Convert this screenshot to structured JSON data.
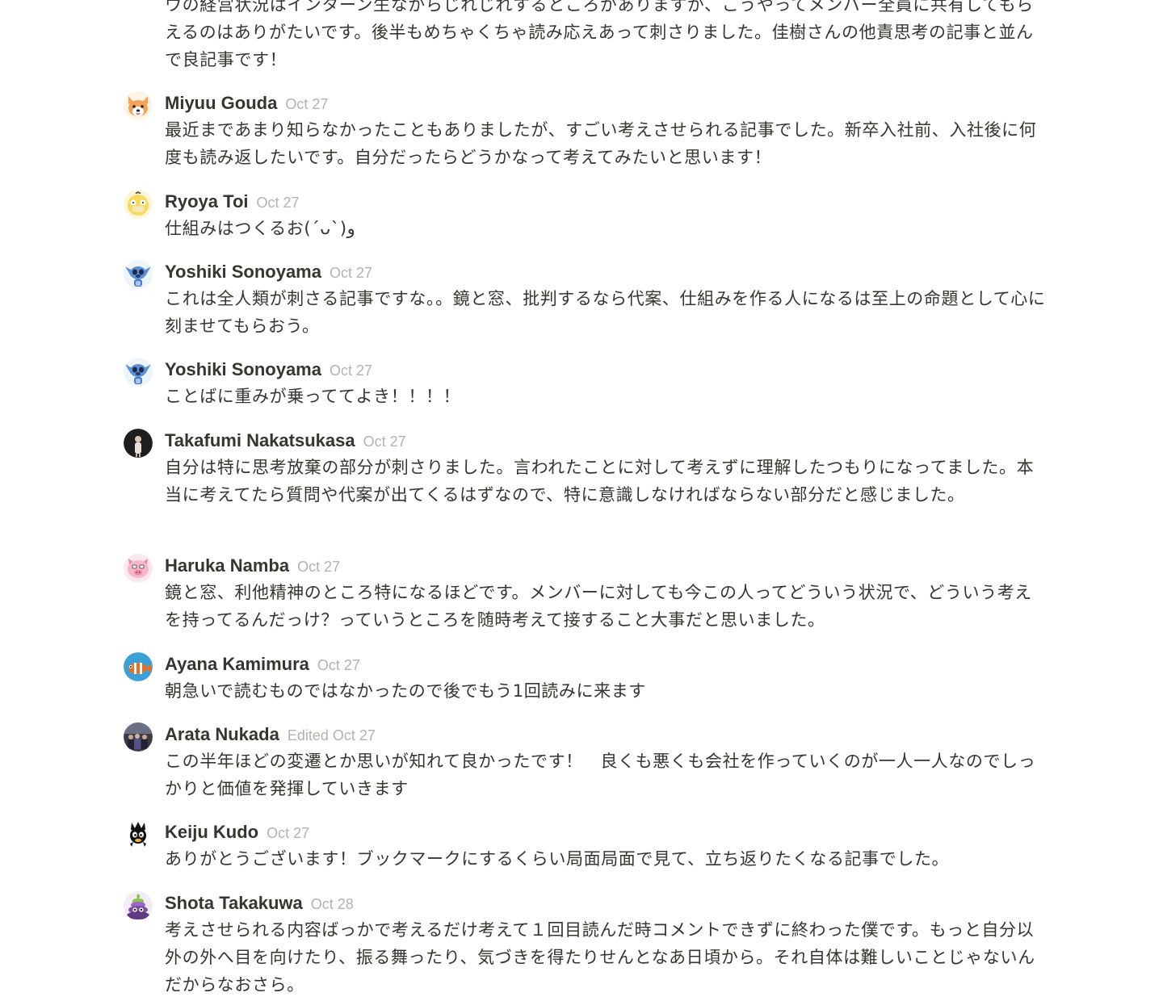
{
  "first_comment": {
    "text": "ウの経営状況はインターン生ながらじれじれするところがありますが、こうやってメンバー全員に共有してもらえるのはありがたいです。後半もめちゃくちゃ読み応えあって刺さりました。佳樹さんの他責思考の記事と並んで良記事です！"
  },
  "comments": [
    {
      "author": "Miyuu Gouda",
      "timestamp": "Oct 27",
      "text": "最近まであまり知らなかったこともありましたが、すごい考えさせられる記事でした。新卒入社前、入社後に何度も読み返したいです。自分だったらどうかなって考えてみたいと思います！",
      "avatar_icon": "corgi-avatar-icon",
      "avatar_color": "#f4a259"
    },
    {
      "author": "Ryoya Toi",
      "timestamp": "Oct 27",
      "text": "仕組みはつくるお(´ᴗ`)و",
      "avatar_icon": "psyduck-avatar-icon",
      "avatar_color": "#f7d95c"
    },
    {
      "author": "Yoshiki Sonoyama",
      "timestamp": "Oct 27",
      "text": "これは全人類が刺さる記事ですな。。鏡と窓、批判するなら代案、仕組みを作る人になるは至上の命題として心に刻ませてもらおう。",
      "avatar_icon": "stitch-avatar-icon",
      "avatar_color": "#5b8fd6"
    },
    {
      "author": "Yoshiki Sonoyama",
      "timestamp": "Oct 27",
      "text": "ことばに重みが乗っててよき！！！！",
      "avatar_icon": "stitch-avatar-icon",
      "avatar_color": "#5b8fd6"
    },
    {
      "author": "Takafumi Nakatsukasa",
      "timestamp": "Oct 27",
      "text": "自分は特に思考放棄の部分が刺さりました。言われたことに対して考えずに理解したつもりになってました。本当に考えてたら質問や代案が出てくるはずなので、特に意識しなければならない部分だと感じました。",
      "avatar_icon": "photo-avatar-icon",
      "avatar_color": "#1e1e1e"
    },
    {
      "author": "Haruka Namba",
      "timestamp": "Oct 27",
      "text": "鏡と窓、利他精神のところ特になるほどです。メンバーに対しても今この人ってどういう状況で、どういう考えを持ってるんだっけ？っていうところを随時考えて接すること大事だと思いました。",
      "avatar_icon": "pig-avatar-icon",
      "avatar_color": "#f5b7c8"
    },
    {
      "author": "Ayana Kamimura",
      "timestamp": "Oct 27",
      "text": "朝急いで読むものではなかったので後でもう1回読みに来ます",
      "avatar_icon": "clownfish-avatar-icon",
      "avatar_color": "#3aa0d8"
    },
    {
      "author": "Arata Nukada",
      "timestamp": "Edited Oct 27",
      "text": "この半年ほどの変遷とか思いが知れて良かったです！　良くも悪くも会社を作っていくのが一人一人なのでしっかりと価値を発揮していきます",
      "avatar_icon": "group-photo-avatar-icon",
      "avatar_color": "#3d3a4a"
    },
    {
      "author": "Keiju Kudo",
      "timestamp": "Oct 27",
      "text": "ありがとうございます！ブックマークにするくらい局面局面で見て、立ち返りたくなる記事でした。",
      "avatar_icon": "badtz-maru-avatar-icon",
      "avatar_color": "#111111"
    },
    {
      "author": "Shota Takakuwa",
      "timestamp": "Oct 28",
      "text": "考えさせられる内容ばっかで考えるだけ考えて１回目読んだ時コメントできずに終わった僕です。もっと自分以外の外へ目を向けたり、振る舞ったり、気づきを得たりせんとなあ日頃から。それ自体は難しいことじゃないんだからなおさら。",
      "avatar_icon": "poop-avatar-icon",
      "avatar_color": "#7a4fa0"
    }
  ]
}
